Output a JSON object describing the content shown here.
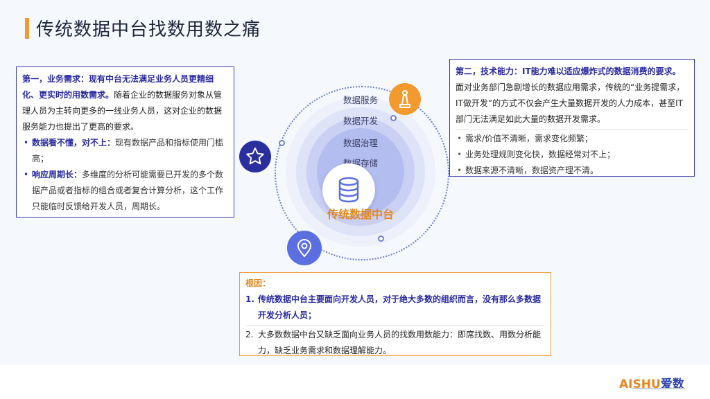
{
  "title": "传统数据中台找数用数之痛",
  "left_box": {
    "heading": "第一，业务需求：现有中台无法满足业务人员更精细化、更实时的用数需求。",
    "body": "随着企业的数据服务对象从管理人员为主转向更多的一线业务人员，这对企业的数据服务能力也提出了更高的要求。",
    "bullets": [
      {
        "label": "数据看不懂，对不上：",
        "text": "现有数据产品和指标使用门槛高；"
      },
      {
        "label": "响应周期长：",
        "text": "多维度的分析可能需要已开发的多个数据产品或者指标的组合或者复合计算分析，这个工作只能临时反馈给开发人员，周期长。"
      }
    ]
  },
  "right_box": {
    "heading": "第二，技术能力：IT能力难以适应爆炸式的数据消费的要求。",
    "body": "面对业务部门急剧增长的数据应用需求，传统的“业务提需求，IT做开发”的方式不仅会产生大量数据开发的人力成本，甚至IT部门无法满足如此大量的数据开发需求。",
    "bullets": [
      "需求/价值不清晰，需求变化频繁；",
      "业务处理规则变化快，数据经常对不上；",
      "数据来源不清晰，数据资产理不清。"
    ]
  },
  "bottom_box": {
    "heading": "根因：",
    "items": [
      {
        "num": "1.",
        "text": "传统数据中台主要面向开发人员，对于绝大多数的组织而言，没有那么多数据开发分析人员；"
      },
      {
        "num": "2.",
        "text": "大多数数据中台又缺乏面向业务人员的找数用数能力：即席找数、用数分析能力，缺乏业务需求和数据理解能力。"
      }
    ]
  },
  "diagram": {
    "layers": [
      "数据服务",
      "数据开发",
      "数据治理",
      "数据存储"
    ],
    "core_label": "传统数据中台",
    "icons": [
      "chess-icon",
      "star-icon",
      "location-icon",
      "database-icon"
    ],
    "colors": {
      "orange": "#f29a2e",
      "navy": "#2b2f9e",
      "blue": "#5b6fe0"
    }
  },
  "logo": {
    "part1": "AISHU",
    "part2": "爱数"
  }
}
